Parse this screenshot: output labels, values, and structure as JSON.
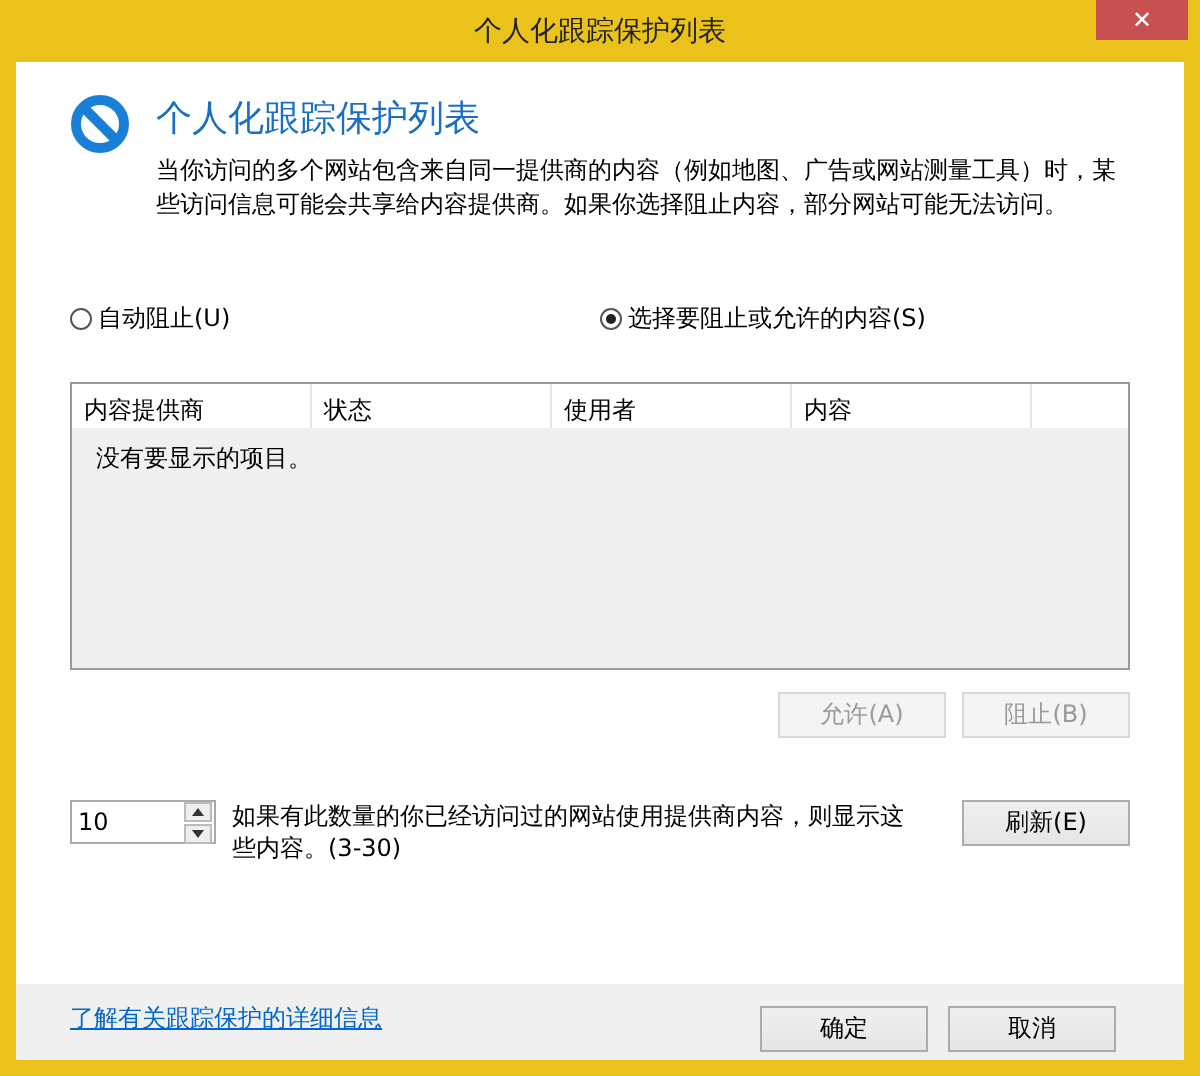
{
  "window": {
    "title": "个人化跟踪保护列表",
    "close": "✕"
  },
  "header": {
    "title": "个人化跟踪保护列表",
    "description": "当你访问的多个网站包含来自同一提供商的内容（例如地图、广告或网站测量工具）时，某些访问信息可能会共享给内容提供商。如果你选择阻止内容，部分网站可能无法访问。"
  },
  "mode": [
    {
      "label": "自动阻止(U)",
      "selected": false
    },
    {
      "label": "选择要阻止或允许的内容(S)",
      "selected": true
    }
  ],
  "table": {
    "columns": [
      "内容提供商",
      "状态",
      "使用者",
      "内容"
    ],
    "empty_text": "没有要显示的项目。"
  },
  "actions": [
    {
      "label": "允许(A)",
      "disabled": true
    },
    {
      "label": "阻止(B)",
      "disabled": true
    }
  ],
  "threshold": {
    "value": "10",
    "label": "如果有此数量的你已经访问过的网站使用提供商内容，则显示这些内容。(3-30)",
    "button": "刷新(E)"
  },
  "footer": {
    "link": "了解有关跟踪保护的详细信息",
    "buttons": [
      "确定",
      "取消"
    ]
  }
}
